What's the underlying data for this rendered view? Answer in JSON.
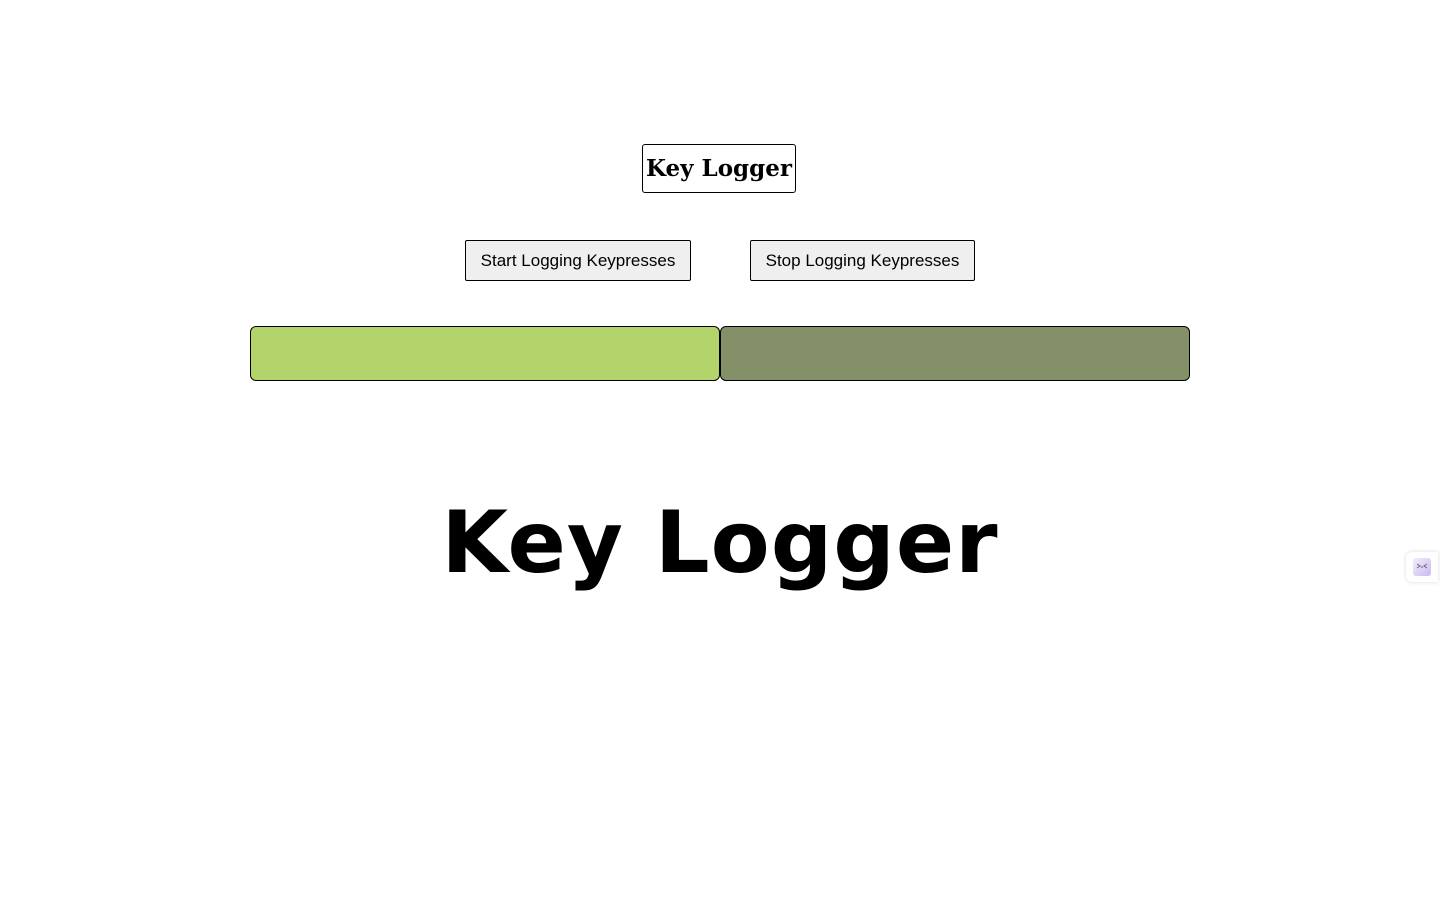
{
  "header": {
    "title": "Key Logger"
  },
  "controls": {
    "start_label": "Start Logging Keypresses",
    "stop_label": "Stop Logging Keypresses"
  },
  "status": {
    "left_color": "#b3d36b",
    "right_color": "#849068"
  },
  "main": {
    "heading": "Key Logger"
  },
  "widget": {
    "icon": "extension-widget-icon"
  }
}
